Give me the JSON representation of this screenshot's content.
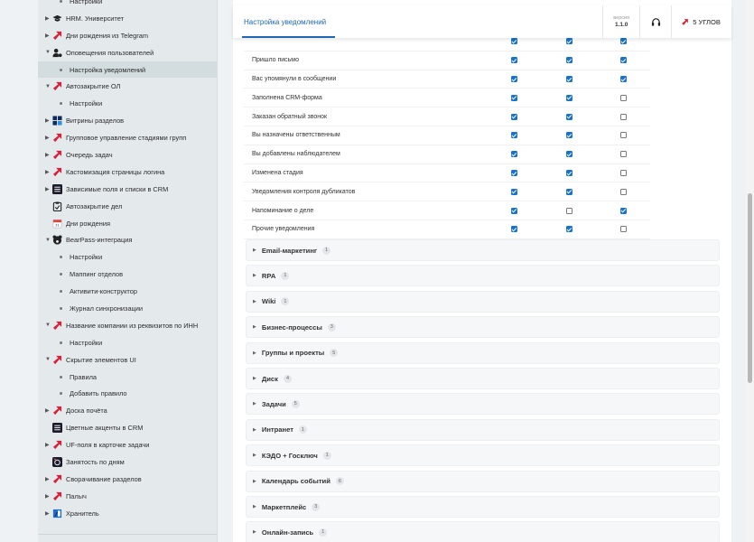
{
  "colors": {
    "accent": "#2067b0",
    "checkbox": "#1a73c8",
    "brand_red": "#d6213a"
  },
  "sidebar": {
    "items": [
      {
        "label": "Настройки",
        "sub": true
      },
      {
        "label": "HRM. Университет",
        "icon": "graduation-cap-icon",
        "arrow": true
      },
      {
        "label": "Дни рождения из Telegram",
        "icon": "red-arrow-icon",
        "arrow": true
      },
      {
        "label": "Оповещения пользователей",
        "icon": "user-bell-icon",
        "arrow": true,
        "open": true
      },
      {
        "label": "Настройка уведомлений",
        "sub": true,
        "active": true
      },
      {
        "label": "Автозакрытие ОЛ",
        "icon": "red-arrow-icon",
        "arrow": true,
        "open": true
      },
      {
        "label": "Настройки",
        "sub": true
      },
      {
        "label": "Витрины разделов",
        "icon": "grid-icon",
        "arrow": true
      },
      {
        "label": "Групповое управление стадиями групп",
        "icon": "red-arrow-icon",
        "arrow": true
      },
      {
        "label": "Очередь задач",
        "icon": "red-arrow-icon",
        "arrow": true
      },
      {
        "label": "Кастомизация страницы логина",
        "icon": "red-arrow-icon",
        "arrow": true
      },
      {
        "label": "Зависимые поля и списки в CRM",
        "icon": "list-icon",
        "arrow": true
      },
      {
        "label": "Автозакрытие дел",
        "icon": "clipboard-icon",
        "arrow": false
      },
      {
        "label": "Дни рождения",
        "icon": "calendar-icon",
        "arrow": false
      },
      {
        "label": "BearPass-интеграция",
        "icon": "bear-icon",
        "arrow": true,
        "open": true
      },
      {
        "label": "Настройки",
        "sub": true
      },
      {
        "label": "Маппинг отделов",
        "sub": true
      },
      {
        "label": "Активити-конструктор",
        "sub": true
      },
      {
        "label": "Журнал синхронизации",
        "sub": true
      },
      {
        "label": "Название компании из реквизитов по ИНН",
        "icon": "red-arrow-icon",
        "arrow": true,
        "open": true
      },
      {
        "label": "Настройки",
        "sub": true
      },
      {
        "label": "Скрытие элементов UI",
        "icon": "red-arrow-icon",
        "arrow": true,
        "open": true
      },
      {
        "label": "Правила",
        "sub": true
      },
      {
        "label": "Добавить правило",
        "sub": true
      },
      {
        "label": "Доска почёта",
        "icon": "red-arrow-icon",
        "arrow": true
      },
      {
        "label": "Цветные акценты в CRM",
        "icon": "list-icon",
        "arrow": false
      },
      {
        "label": "UF-поля в карточке задачи",
        "icon": "red-arrow-icon",
        "arrow": true
      },
      {
        "label": "Занятость по дням",
        "icon": "camera-icon",
        "arrow": false
      },
      {
        "label": "Сворачивание разделов",
        "icon": "red-arrow-icon",
        "arrow": true
      },
      {
        "label": "Палыч",
        "icon": "red-arrow-icon",
        "arrow": true
      },
      {
        "label": "Хранитель",
        "icon": "book-icon",
        "arrow": true
      }
    ]
  },
  "header": {
    "tab_label": "Настройка уведомлений",
    "version_label": "версия",
    "version_value": "1.1.0",
    "brand_label": "5 УГЛОВ"
  },
  "notifications": [
    {
      "label": "",
      "c": [
        true,
        true,
        true
      ]
    },
    {
      "label": "Пришло письмо",
      "c": [
        true,
        true,
        true
      ]
    },
    {
      "label": "Вас упомянули в сообщении",
      "c": [
        true,
        true,
        true
      ]
    },
    {
      "label": "Заполнена CRM-форма",
      "c": [
        true,
        true,
        false
      ]
    },
    {
      "label": "Заказан обратный звонок",
      "c": [
        true,
        true,
        false
      ]
    },
    {
      "label": "Вы назначены ответственным",
      "c": [
        true,
        true,
        false
      ]
    },
    {
      "label": "Вы добавлены наблюдателем",
      "c": [
        true,
        true,
        false
      ]
    },
    {
      "label": "Изменена стадия",
      "c": [
        true,
        true,
        false
      ]
    },
    {
      "label": "Уведомления контроля дубликатов",
      "c": [
        true,
        true,
        false
      ]
    },
    {
      "label": "Напоминание о деле",
      "c": [
        true,
        false,
        true
      ]
    },
    {
      "label": "Прочие уведомления",
      "c": [
        true,
        true,
        false
      ]
    }
  ],
  "sections": [
    {
      "name": "Email-маркетинг",
      "count": "1"
    },
    {
      "name": "RPA",
      "count": "1"
    },
    {
      "name": "Wiki",
      "count": "1"
    },
    {
      "name": "Бизнес-процессы",
      "count": "3"
    },
    {
      "name": "Группы и проекты",
      "count": "5"
    },
    {
      "name": "Диск",
      "count": "4"
    },
    {
      "name": "Задачи",
      "count": "5"
    },
    {
      "name": "Интранет",
      "count": "1"
    },
    {
      "name": "КЭДО + Госключ",
      "count": "1"
    },
    {
      "name": "Календарь событий",
      "count": "6"
    },
    {
      "name": "Маркетплейс",
      "count": "3"
    },
    {
      "name": "Онлайн-запись",
      "count": "1"
    }
  ]
}
